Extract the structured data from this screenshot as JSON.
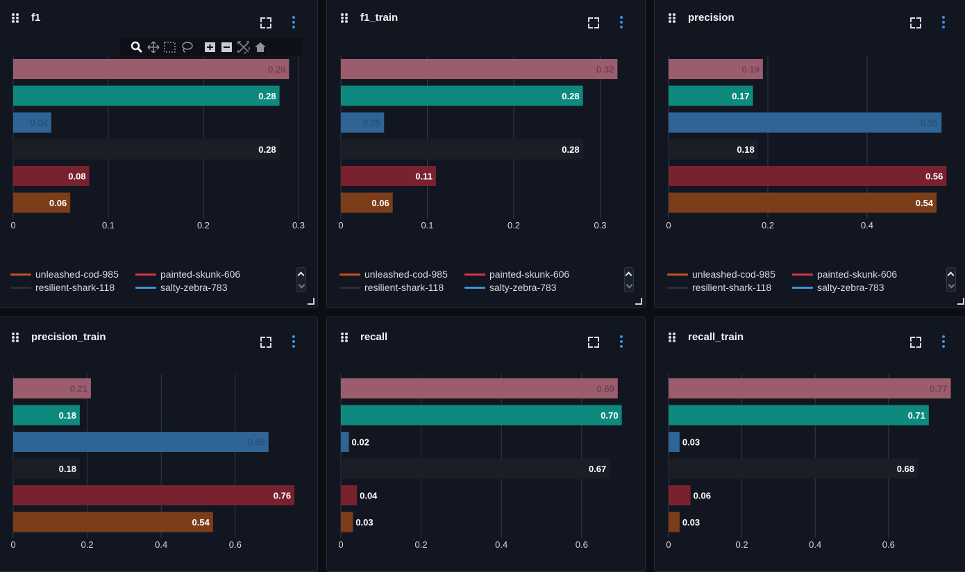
{
  "legend": {
    "items": [
      {
        "label": "unleashed-cod-985",
        "color": "#c0531e"
      },
      {
        "label": "painted-skunk-606",
        "color": "#d63447"
      },
      {
        "label": "resilient-shark-118",
        "color": "#2a2f38"
      },
      {
        "label": "salty-zebra-783",
        "color": "#3f92da"
      }
    ]
  },
  "bar_colors": [
    "#9b5d6e",
    "#0d8a7d",
    "#2e6596",
    "#1a1f27",
    "#78212f",
    "#7c3d1b"
  ],
  "modebar_icons": [
    "zoom-icon",
    "pan-icon",
    "box-select-icon",
    "lasso-select-icon",
    "zoom-in-icon",
    "zoom-out-icon",
    "autoscale-icon",
    "reset-axes-icon"
  ],
  "chart_data": [
    {
      "type": "bar",
      "title": "f1",
      "orientation": "horizontal",
      "values": [
        0.29,
        0.28,
        0.04,
        0.28,
        0.08,
        0.06
      ],
      "labels": [
        "0.29",
        "0.28",
        "0.04",
        "0.28",
        "0.08",
        "0.06"
      ],
      "xticks": [
        "0",
        "0.1",
        "0.2",
        "0.3"
      ],
      "xlim": [
        0,
        0.3
      ],
      "grid": true
    },
    {
      "type": "bar",
      "title": "f1_train",
      "orientation": "horizontal",
      "values": [
        0.32,
        0.28,
        0.05,
        0.28,
        0.11,
        0.06
      ],
      "labels": [
        "0.32",
        "0.28",
        "0.05",
        "0.28",
        "0.11",
        "0.06"
      ],
      "xticks": [
        "0",
        "0.1",
        "0.2",
        "0.3"
      ],
      "xlim": [
        0,
        0.3
      ],
      "grid": true
    },
    {
      "type": "bar",
      "title": "precision",
      "orientation": "horizontal",
      "values": [
        0.19,
        0.17,
        0.55,
        0.18,
        0.56,
        0.54
      ],
      "labels": [
        "0.19",
        "0.17",
        "0.55",
        "0.18",
        "0.56",
        "0.54"
      ],
      "xticks": [
        "0",
        "0.2",
        "0.4"
      ],
      "xlim": [
        0,
        0.4
      ],
      "grid": true
    },
    {
      "type": "bar",
      "title": "precision_train",
      "orientation": "horizontal",
      "values": [
        0.21,
        0.18,
        0.69,
        0.18,
        0.76,
        0.54
      ],
      "labels": [
        "0.21",
        "0.18",
        "0.69",
        "0.18",
        "0.76",
        "0.54"
      ],
      "xticks": [
        "0",
        "0.2",
        "0.4",
        "0.6"
      ],
      "xlim": [
        0,
        0.6
      ],
      "grid": true
    },
    {
      "type": "bar",
      "title": "recall",
      "orientation": "horizontal",
      "values": [
        0.69,
        0.7,
        0.02,
        0.67,
        0.04,
        0.03
      ],
      "labels": [
        "0.69",
        "0.70",
        "0.02",
        "0.67",
        "0.04",
        "0.03"
      ],
      "xticks": [
        "0",
        "0.2",
        "0.4",
        "0.6"
      ],
      "xlim": [
        0,
        0.6
      ],
      "grid": true
    },
    {
      "type": "bar",
      "title": "recall_train",
      "orientation": "horizontal",
      "values": [
        0.77,
        0.71,
        0.03,
        0.68,
        0.06,
        0.03
      ],
      "labels": [
        "0.77",
        "0.71",
        "0.03",
        "0.68",
        "0.06",
        "0.03"
      ],
      "xticks": [
        "0",
        "0.2",
        "0.4",
        "0.6"
      ],
      "xlim": [
        0,
        0.6
      ],
      "grid": true
    }
  ]
}
